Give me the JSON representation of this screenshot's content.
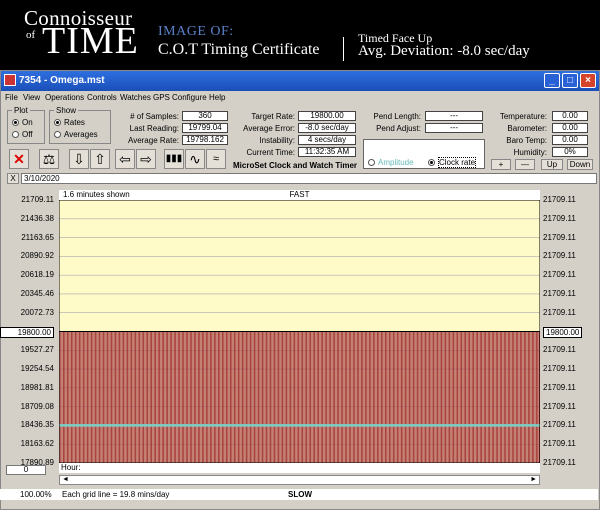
{
  "banner": {
    "logo_line1": "Connoisseur",
    "logo_of": "of",
    "logo_time": "TIME",
    "image_of": "IMAGE OF:",
    "certificate": "C.O.T Timing Certificate",
    "face": "Timed Face Up",
    "avg_deviation": "Avg. Deviation: -8.0 sec/day"
  },
  "window": {
    "title": "7354 - Omega.mst",
    "menu": [
      "File",
      "View",
      "Operations",
      "Controls",
      "Watches",
      "GPS",
      "Configure",
      "Help"
    ]
  },
  "plot_group": {
    "title": "Plot",
    "on": "On",
    "off": "Off",
    "selected": "On"
  },
  "show_group": {
    "title": "Show",
    "rates": "Rates",
    "averages": "Averages",
    "selected": "Rates"
  },
  "stats": {
    "samples_label": "# of Samples:",
    "samples": "360",
    "last_label": "Last Reading:",
    "last": "19799.04",
    "avg_label": "Average Rate:",
    "avg": "19798.162",
    "target_label": "Target Rate:",
    "target": "19800.00",
    "error_label": "Average Error:",
    "error": "-8.0 sec/day",
    "instab_label": "Instability:",
    "instab": "4 secs/day",
    "time_label": "Current Time:",
    "time": "11:32:35 AM",
    "pend_len_label": "Pend Length:",
    "pend_len": "---",
    "pend_adj_label": "Pend Adjust:",
    "pend_adj": "---",
    "temp_label": "Temperature:",
    "temp": "0.00",
    "baro_label": "Barometer:",
    "baro": "0.00",
    "barotemp_label": "Baro Temp:",
    "barotemp": "0.00",
    "hum_label": "Humidity:",
    "hum": "0%",
    "app_name": "MicroSet Clock and Watch Timer",
    "amplitude": "Amplitude",
    "clock_rate": "Clock rate",
    "plus": "+",
    "minus": "—",
    "up": "Up",
    "down": "Down"
  },
  "date": {
    "x": "X",
    "value": "3/10/2020"
  },
  "chart": {
    "minutes_shown": "1.6 minutes shown",
    "fast": "FAST",
    "slow": "SLOW",
    "hour": "Hour:",
    "zoom": "100.00%",
    "grid_note": "Each grid line = 19.8 mins/day",
    "counter": "0",
    "y_ticks": [
      "21709.11",
      "21436.38",
      "21163.65",
      "20890.92",
      "20618.19",
      "20345.46",
      "20072.73",
      "19800.00",
      "19527.27",
      "19254.54",
      "18981.81",
      "18709.08",
      "18436.35",
      "18163.62",
      "17890.89"
    ],
    "target_label": "19800.00",
    "right_label": "21709.11",
    "colors": {
      "fast_bg": "#fffbc8",
      "bars": "#9b2020",
      "trend": "#7ad0c8"
    }
  },
  "chart_data": {
    "type": "bar",
    "title": "",
    "xlabel": "Hour:",
    "ylabel": "",
    "ylim": [
      17890.89,
      21709.11
    ],
    "reference_line": 19800.0,
    "trend_value": 18436.35,
    "samples": 360,
    "bar_value": 19799.04
  }
}
